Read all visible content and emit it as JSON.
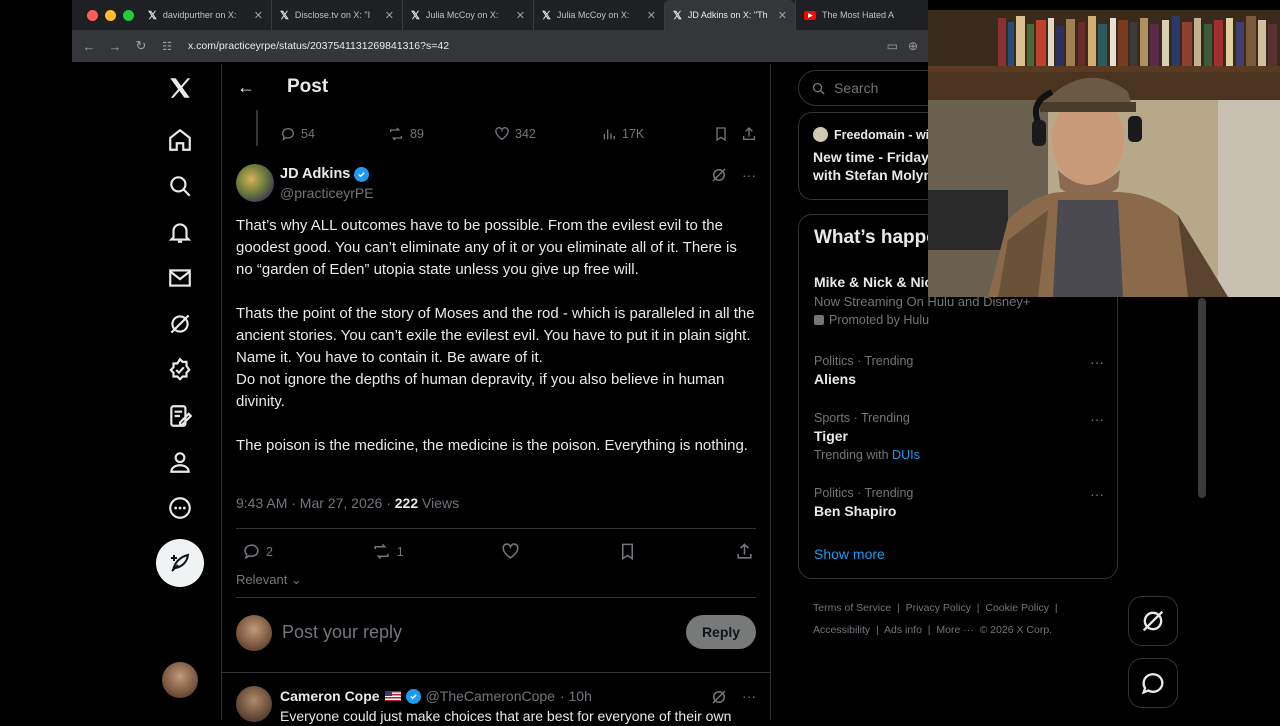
{
  "browser": {
    "tabs": [
      {
        "label": "davidpurther on X: ",
        "icon": "x-logo"
      },
      {
        "label": "Disclose.tv on X: \"I",
        "icon": "x-logo"
      },
      {
        "label": "Julia McCoy on X: ",
        "icon": "x-logo"
      },
      {
        "label": "Julia McCoy on X: ",
        "icon": "x-logo"
      },
      {
        "label": "JD Adkins on X: \"Th",
        "icon": "x-logo"
      },
      {
        "label": "The Most Hated A",
        "icon": "youtube-icon"
      }
    ],
    "url": "x.com/practiceyrpe/status/2037541131269841316?s=42"
  },
  "header": {
    "title": "Post"
  },
  "prev_actions": {
    "replies": "54",
    "reposts": "89",
    "likes": "342",
    "views": "17K"
  },
  "tweet": {
    "name": "JD Adkins",
    "handle": "@practiceyrPE",
    "paragraphs": [
      "That’s why ALL outcomes have to be possible.  From the evilest evil to the goodest good.  You can’t eliminate any of it or you eliminate all of it.  There is no “garden of Eden” utopia state unless you give up free will.",
      "",
      "Thats the point of the story of Moses and the rod - which is paralleled in all the ancient  stories.  You can’t exile the evilest evil.  You have to put it in plain sight.  Name it.  You have to contain it.  Be aware of it.",
      "Do not ignore the depths of human depravity, if you also believe in human divinity.",
      "",
      "The poison is the medicine, the medicine is the poison.  Everything is nothing."
    ],
    "time": "9:43 AM · Mar 27, 2026 · ",
    "views_count": "222",
    "views_label": " Views",
    "replies": "2",
    "reposts": "1"
  },
  "sort": {
    "label": "Relevant"
  },
  "reply": {
    "placeholder": "Post your reply",
    "button": "Reply"
  },
  "next_reply": {
    "name": "Cameron Cope",
    "handle": "@TheCameronCope",
    "time": "· 10h",
    "text": "Everyone could just make choices that are best for everyone of their own"
  },
  "sidebar": {
    "search_placeholder": "Search",
    "live": {
      "host": "Freedomain - with",
      "title_line1": "New time - Friday",
      "title_line2": "with Stefan Molyneux"
    },
    "happening": {
      "title": "What’s happening",
      "items": [
        {
          "category": "",
          "title": "Mike & Nick & Nick",
          "sub": "Now Streaming On Hulu and Disney+",
          "promo": "Promoted by Hulu"
        },
        {
          "category": "Politics · Trending",
          "title": "Aliens"
        },
        {
          "category": "Sports · Trending",
          "title": "Tiger",
          "sub_prefix": "Trending with ",
          "sub_link": "DUIs"
        },
        {
          "category": "Politics · Trending",
          "title": "Ben Shapiro"
        }
      ],
      "show_more": "Show more"
    },
    "footer": [
      "Terms of Service",
      "Privacy Policy",
      "Cookie Policy",
      "Accessibility",
      "Ads info",
      "More ···",
      "© 2026 X Corp."
    ]
  }
}
